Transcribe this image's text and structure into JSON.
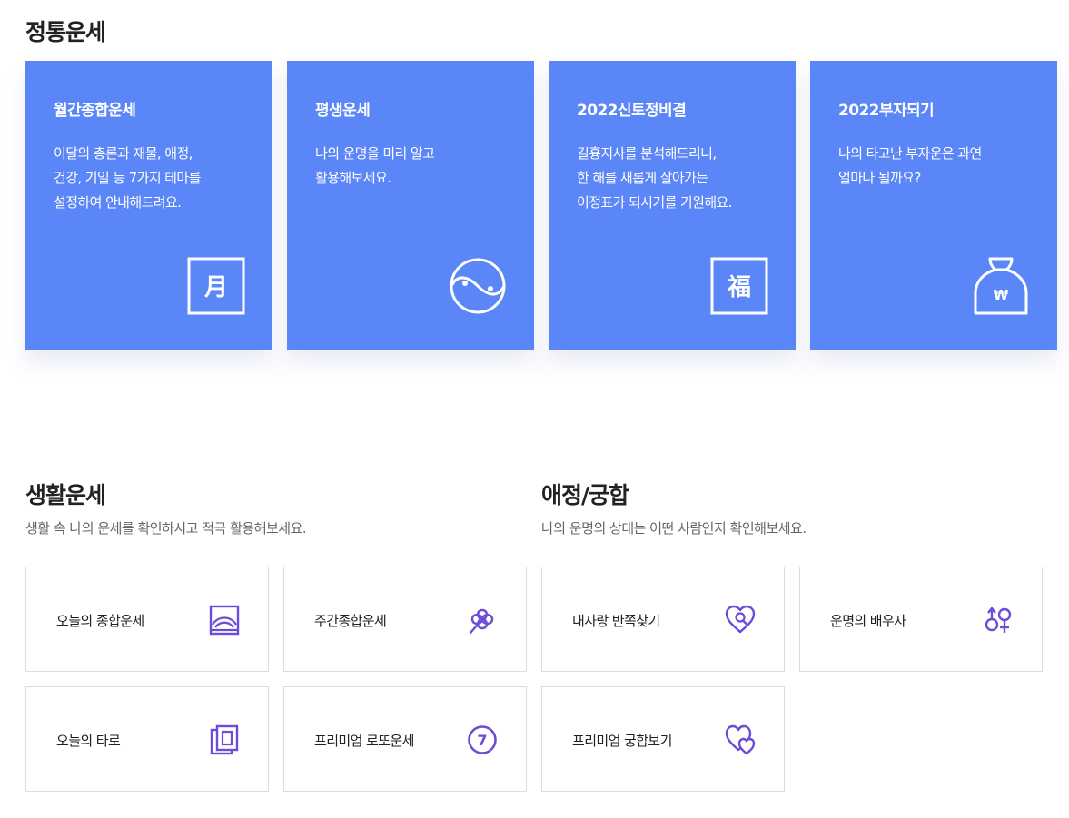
{
  "traditional": {
    "title": "정통운세",
    "cards": [
      {
        "title": "월간종합운세",
        "lines": [
          "이달의 총론과 재물, 애정,",
          "건강, 기일 등 7가지 테마를",
          "설정하여 안내해드려요."
        ],
        "icon": "moon-character-icon",
        "glyph": "月"
      },
      {
        "title": "평생운세",
        "lines": [
          "나의 운명을 미리 알고",
          "활용해보세요."
        ],
        "icon": "yin-yang-icon"
      },
      {
        "title": "2022신토정비결",
        "lines": [
          "길흉지사를 분석해드리니,",
          "한 해를 새롭게 살아가는",
          "이정표가 되시기를 기원해요."
        ],
        "icon": "fortune-character-icon",
        "glyph": "福"
      },
      {
        "title": "2022부자되기",
        "lines": [
          "나의 타고난 부자운은 과연",
          "얼마나 될까요?"
        ],
        "icon": "money-bag-icon",
        "glyph": "₩"
      }
    ]
  },
  "life": {
    "title": "생활운세",
    "desc": "생활 속 나의 운세를 확인하시고 적극 활용해보세요.",
    "items": [
      {
        "label": "오늘의 종합운세",
        "icon": "sunrise-icon"
      },
      {
        "label": "주간종합운세",
        "icon": "clover-icon"
      },
      {
        "label": "오늘의 타로",
        "icon": "tarot-cards-icon"
      },
      {
        "label": "프리미엄 로또운세",
        "icon": "lotto-ball-icon",
        "glyph": "7"
      }
    ]
  },
  "love": {
    "title": "애정/궁합",
    "desc": "나의 운명의 상대는 어떤 사람인지 확인해보세요.",
    "items": [
      {
        "label": "내사랑 반쪽찾기",
        "icon": "heart-search-icon"
      },
      {
        "label": "운명의 배우자",
        "icon": "gender-symbols-icon"
      },
      {
        "label": "프리미엄 궁합보기",
        "icon": "double-heart-icon"
      }
    ]
  },
  "colors": {
    "card_bg": "#5b86f7",
    "icon_purple": "#6c4cd8"
  }
}
